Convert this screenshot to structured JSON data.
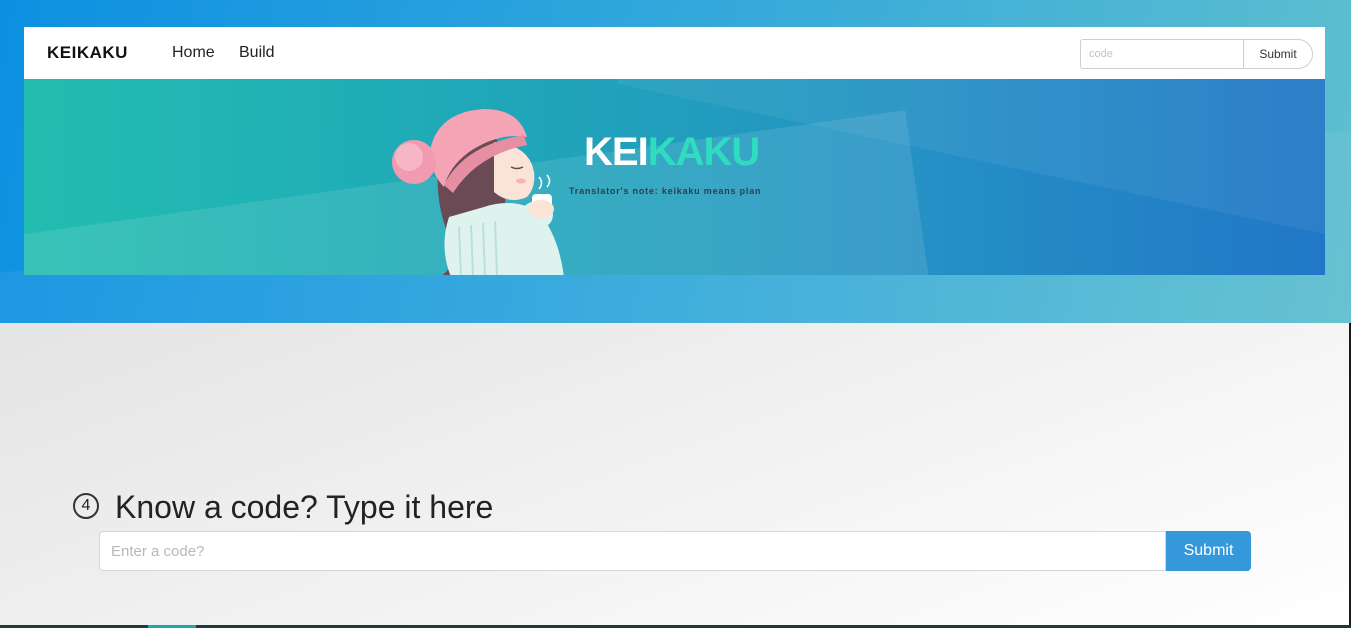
{
  "navbar": {
    "brand": "KEIKAKU",
    "links": [
      "Home",
      "Build"
    ],
    "code_placeholder": "code",
    "submit_label": "Submit"
  },
  "banner": {
    "title_part1": "KEI",
    "title_part2": "KAKU",
    "note": "Translator's note: keikaku means plan"
  },
  "code_section": {
    "step_number": "4",
    "heading": "Know a code? Type it here",
    "input_placeholder": "Enter a code?",
    "submit_label": "Submit"
  },
  "colors": {
    "accent_teal": "#2fdcc0",
    "button_blue": "#3498db"
  }
}
